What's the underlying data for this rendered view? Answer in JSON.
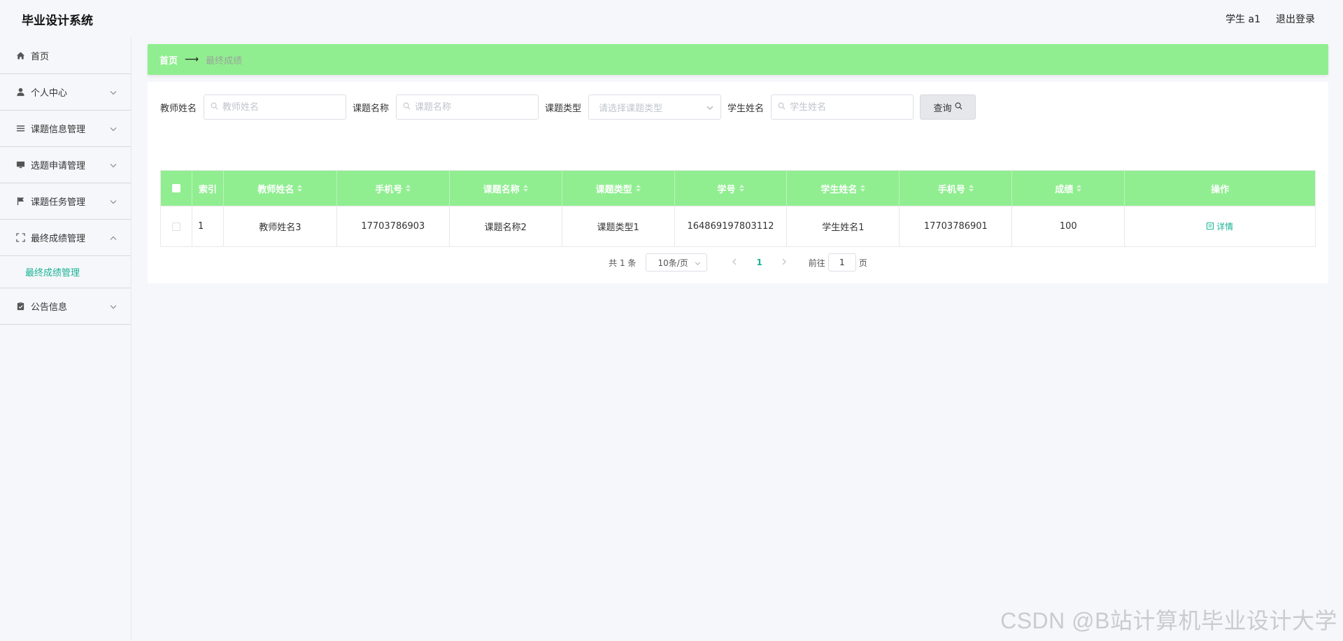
{
  "header": {
    "title": "毕业设计系统",
    "user": "学生 a1",
    "logout": "退出登录"
  },
  "sidebar": {
    "items": [
      {
        "label": "首页",
        "icon": "home-icon"
      },
      {
        "label": "个人中心",
        "icon": "user-icon"
      },
      {
        "label": "课题信息管理",
        "icon": "list-icon"
      },
      {
        "label": "选题申请管理",
        "icon": "monitor-icon"
      },
      {
        "label": "课题任务管理",
        "icon": "flag-icon"
      },
      {
        "label": "最终成绩管理",
        "icon": "fullscreen-icon"
      },
      {
        "label": "公告信息",
        "icon": "clipboard-icon"
      }
    ],
    "submenu": {
      "label": "最终成绩管理"
    }
  },
  "breadcrumb": {
    "home": "首页",
    "current": "最终成绩"
  },
  "filters": {
    "teacher_label": "教师姓名",
    "teacher_placeholder": "教师姓名",
    "topic_label": "课题名称",
    "topic_placeholder": "课题名称",
    "type_label": "课题类型",
    "type_placeholder": "请选择课题类型",
    "student_label": "学生姓名",
    "student_placeholder": "学生姓名",
    "search_button": "查询"
  },
  "table": {
    "columns": [
      "索引",
      "教师姓名",
      "手机号",
      "课题名称",
      "课题类型",
      "学号",
      "学生姓名",
      "手机号",
      "成绩",
      "操作"
    ],
    "rows": [
      {
        "index": "1",
        "teacher": "教师姓名3",
        "teacher_phone": "17703786903",
        "topic": "课题名称2",
        "type": "课题类型1",
        "student_id": "164869197803112",
        "student": "学生姓名1",
        "student_phone": "17703786901",
        "score": "100",
        "action": "详情"
      }
    ]
  },
  "pagination": {
    "total": "共 1 条",
    "page_size": "10条/页",
    "current": "1",
    "goto": "前往",
    "page_input": "1",
    "page_unit": "页"
  },
  "watermark": "CSDN @B站计算机毕业设计大学",
  "colors": {
    "accent": "#90ee90",
    "link": "#1ab394"
  }
}
